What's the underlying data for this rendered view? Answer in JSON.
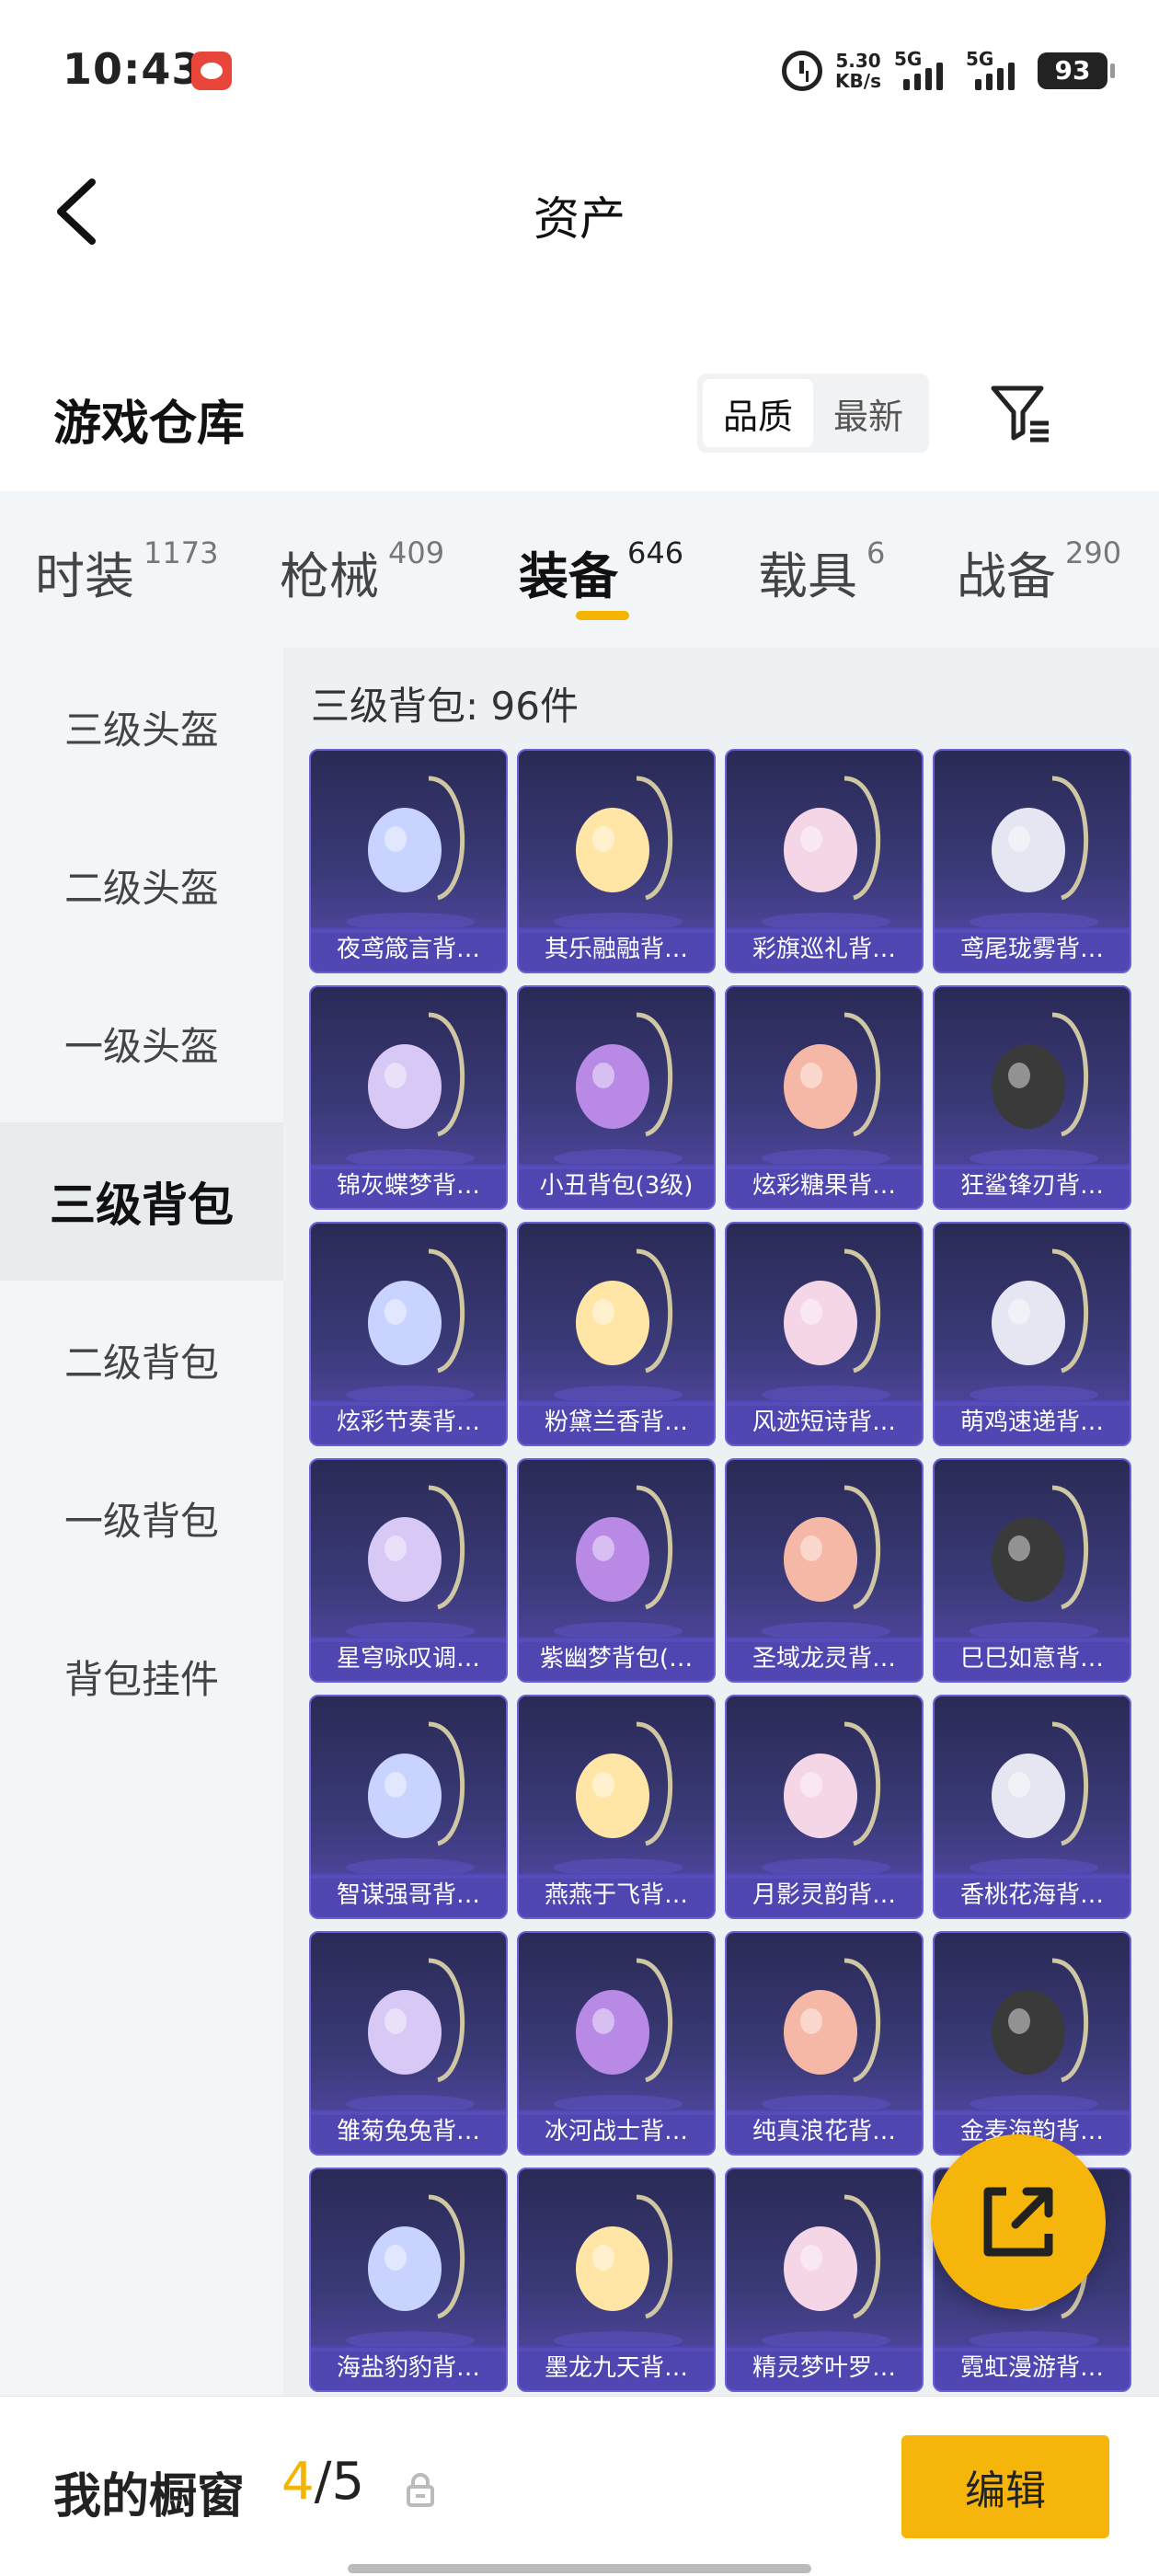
{
  "status": {
    "time": "10:43",
    "net_speed_value": "5.30",
    "net_speed_unit": "KB/s",
    "sim1": "5G",
    "sim2": "5G",
    "battery": "93"
  },
  "header": {
    "title": "资产"
  },
  "section": {
    "title": "游戏仓库",
    "sort_options": [
      "品质",
      "最新"
    ],
    "sort_active": "品质"
  },
  "tabs": [
    {
      "label": "时装",
      "count": "1173"
    },
    {
      "label": "枪械",
      "count": "409"
    },
    {
      "label": "装备",
      "count": "646"
    },
    {
      "label": "载具",
      "count": "6"
    },
    {
      "label": "战备",
      "count": "290"
    }
  ],
  "active_tab": "装备",
  "sidebar": {
    "items": [
      "三级头盔",
      "二级头盔",
      "一级头盔",
      "三级背包",
      "二级背包",
      "一级背包",
      "背包挂件"
    ],
    "active": "三级背包"
  },
  "content": {
    "header": "三级背包: 96件",
    "items": [
      "夜鸢箴言背…",
      "其乐融融背…",
      "彩旗巡礼背…",
      "鸢尾珑雾背…",
      "锦灰蝶梦背…",
      "小丑背包(3级)",
      "炫彩糖果背…",
      "狂鲨锋刃背…",
      "炫彩节奏背…",
      "粉黛兰香背…",
      "风迹短诗背…",
      "萌鸡速递背…",
      "星穹咏叹调…",
      "紫幽梦背包(…",
      "圣域龙灵背…",
      "巳巳如意背…",
      "智谋强哥背…",
      "燕燕于飞背…",
      "月影灵韵背…",
      "香桃花海背…",
      "雏菊兔兔背…",
      "冰河战士背…",
      "纯真浪花背…",
      "金麦海韵背…",
      "海盐豹豹背…",
      "墨龙九天背…",
      "精灵梦叶罗…",
      "霓虹漫游背…"
    ]
  },
  "bottom": {
    "label": "我的橱窗",
    "current": "4",
    "separator": "/",
    "total": "5",
    "edit_label": "编辑"
  },
  "colors": {
    "accent": "#f5b400",
    "card_bg": "#3a3a78",
    "card_label_bg": "#5046b4"
  }
}
